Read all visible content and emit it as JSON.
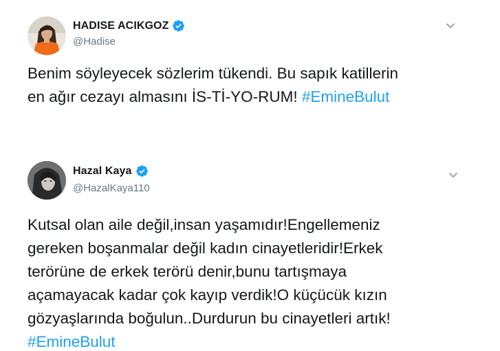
{
  "tweets": [
    {
      "display_name": "HADISE ACIKGOZ",
      "handle": "@Hadise",
      "verified": true,
      "avatar_icon": "hadise-avatar",
      "text_lines": [
        "Benim söyleyecek sözlerim tükendi. Bu sapık katillerin",
        "en ağır cezayı almasını İS-Tİ-YO-RUM! "
      ],
      "hashtag": "#EmineBulut"
    },
    {
      "display_name": "Hazal Kaya",
      "handle": "@HazalKaya110",
      "verified": true,
      "avatar_icon": "hazal-avatar",
      "text_lines": [
        "Kutsal olan aile değil,insan yaşamıdır!Engellemeniz",
        "gereken boşanmalar değil kadın cinayetleridir!Erkek",
        "terörüne de erkek terörü denir,bunu tartışmaya",
        "açamayacak kadar çok kayıp verdik!O küçücük kızın",
        "gözyaşlarında boğulun..Durdurun bu cinayetleri artık!"
      ],
      "hashtag": "#EmineBulut"
    }
  ],
  "colors": {
    "text": "#14171a",
    "secondary": "#657786",
    "link": "#1da1f2",
    "verified": "#1da1f2"
  }
}
